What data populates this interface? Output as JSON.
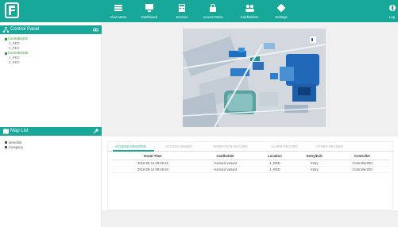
{
  "header": {
    "nav": [
      {
        "label": "View Menu",
        "icon": "list-icon"
      },
      {
        "label": "Dashboard",
        "icon": "monitor-icon"
      },
      {
        "label": "Devices",
        "icon": "calculator-icon"
      },
      {
        "label": "Access Rules",
        "icon": "lock-icon"
      },
      {
        "label": "Cardholders",
        "icon": "users-icon"
      },
      {
        "label": "Settings",
        "icon": "gear-icon"
      }
    ],
    "logout_label": "Log",
    "accent": "#17a89a"
  },
  "control_panel": {
    "title": "Control Panel",
    "controllers": [
      {
        "name": "Controller202",
        "doors": [
          "1_RED",
          "2_RED"
        ]
      },
      {
        "name": "Controller250",
        "doors": [
          "1_RED",
          "2_RED"
        ]
      }
    ]
  },
  "map_list": {
    "title": "Map List",
    "items": [
      "demoflat",
      "Company"
    ]
  },
  "records": {
    "tabs": [
      "ACCESS GRANTED",
      "ACCESS DENIED",
      "OPERATION RECORD",
      "ALARM RECORD",
      "OTHER RECORD"
    ],
    "columns": [
      "Event Time",
      "Cardholder",
      "Location",
      "Entry/Exit",
      "Controller"
    ],
    "rows": [
      [
        "2016-08-14 09:26:16",
        "Harvard Vasant",
        "1_RED",
        "Entry",
        "Controller250"
      ],
      [
        "2016-08-14 09:26:04",
        "Harvard Vasant",
        "1_RED",
        "Entry",
        "Controller250"
      ]
    ]
  }
}
